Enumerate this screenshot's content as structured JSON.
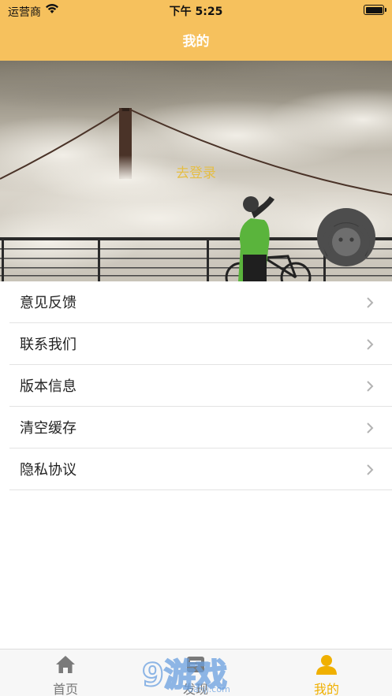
{
  "status_bar": {
    "carrier": "运营商",
    "time": "下午 5:25"
  },
  "nav": {
    "title": "我的"
  },
  "hero": {
    "login_label": "去登录"
  },
  "menu": {
    "items": [
      {
        "label": "意见反馈"
      },
      {
        "label": "联系我们"
      },
      {
        "label": "版本信息"
      },
      {
        "label": "清空缓存"
      },
      {
        "label": "隐私协议"
      }
    ]
  },
  "tabbar": {
    "tabs": [
      {
        "label": "首页",
        "icon": "home-icon",
        "active": false
      },
      {
        "label": "发现",
        "icon": "discover-icon",
        "active": false
      },
      {
        "label": "我的",
        "icon": "person-icon",
        "active": true
      }
    ]
  },
  "watermark": {
    "text": "9游戏",
    "sub": "danji.com"
  },
  "colors": {
    "accent": "#f6c15d",
    "login_text": "#e5be45",
    "active_tab": "#f0b000"
  }
}
